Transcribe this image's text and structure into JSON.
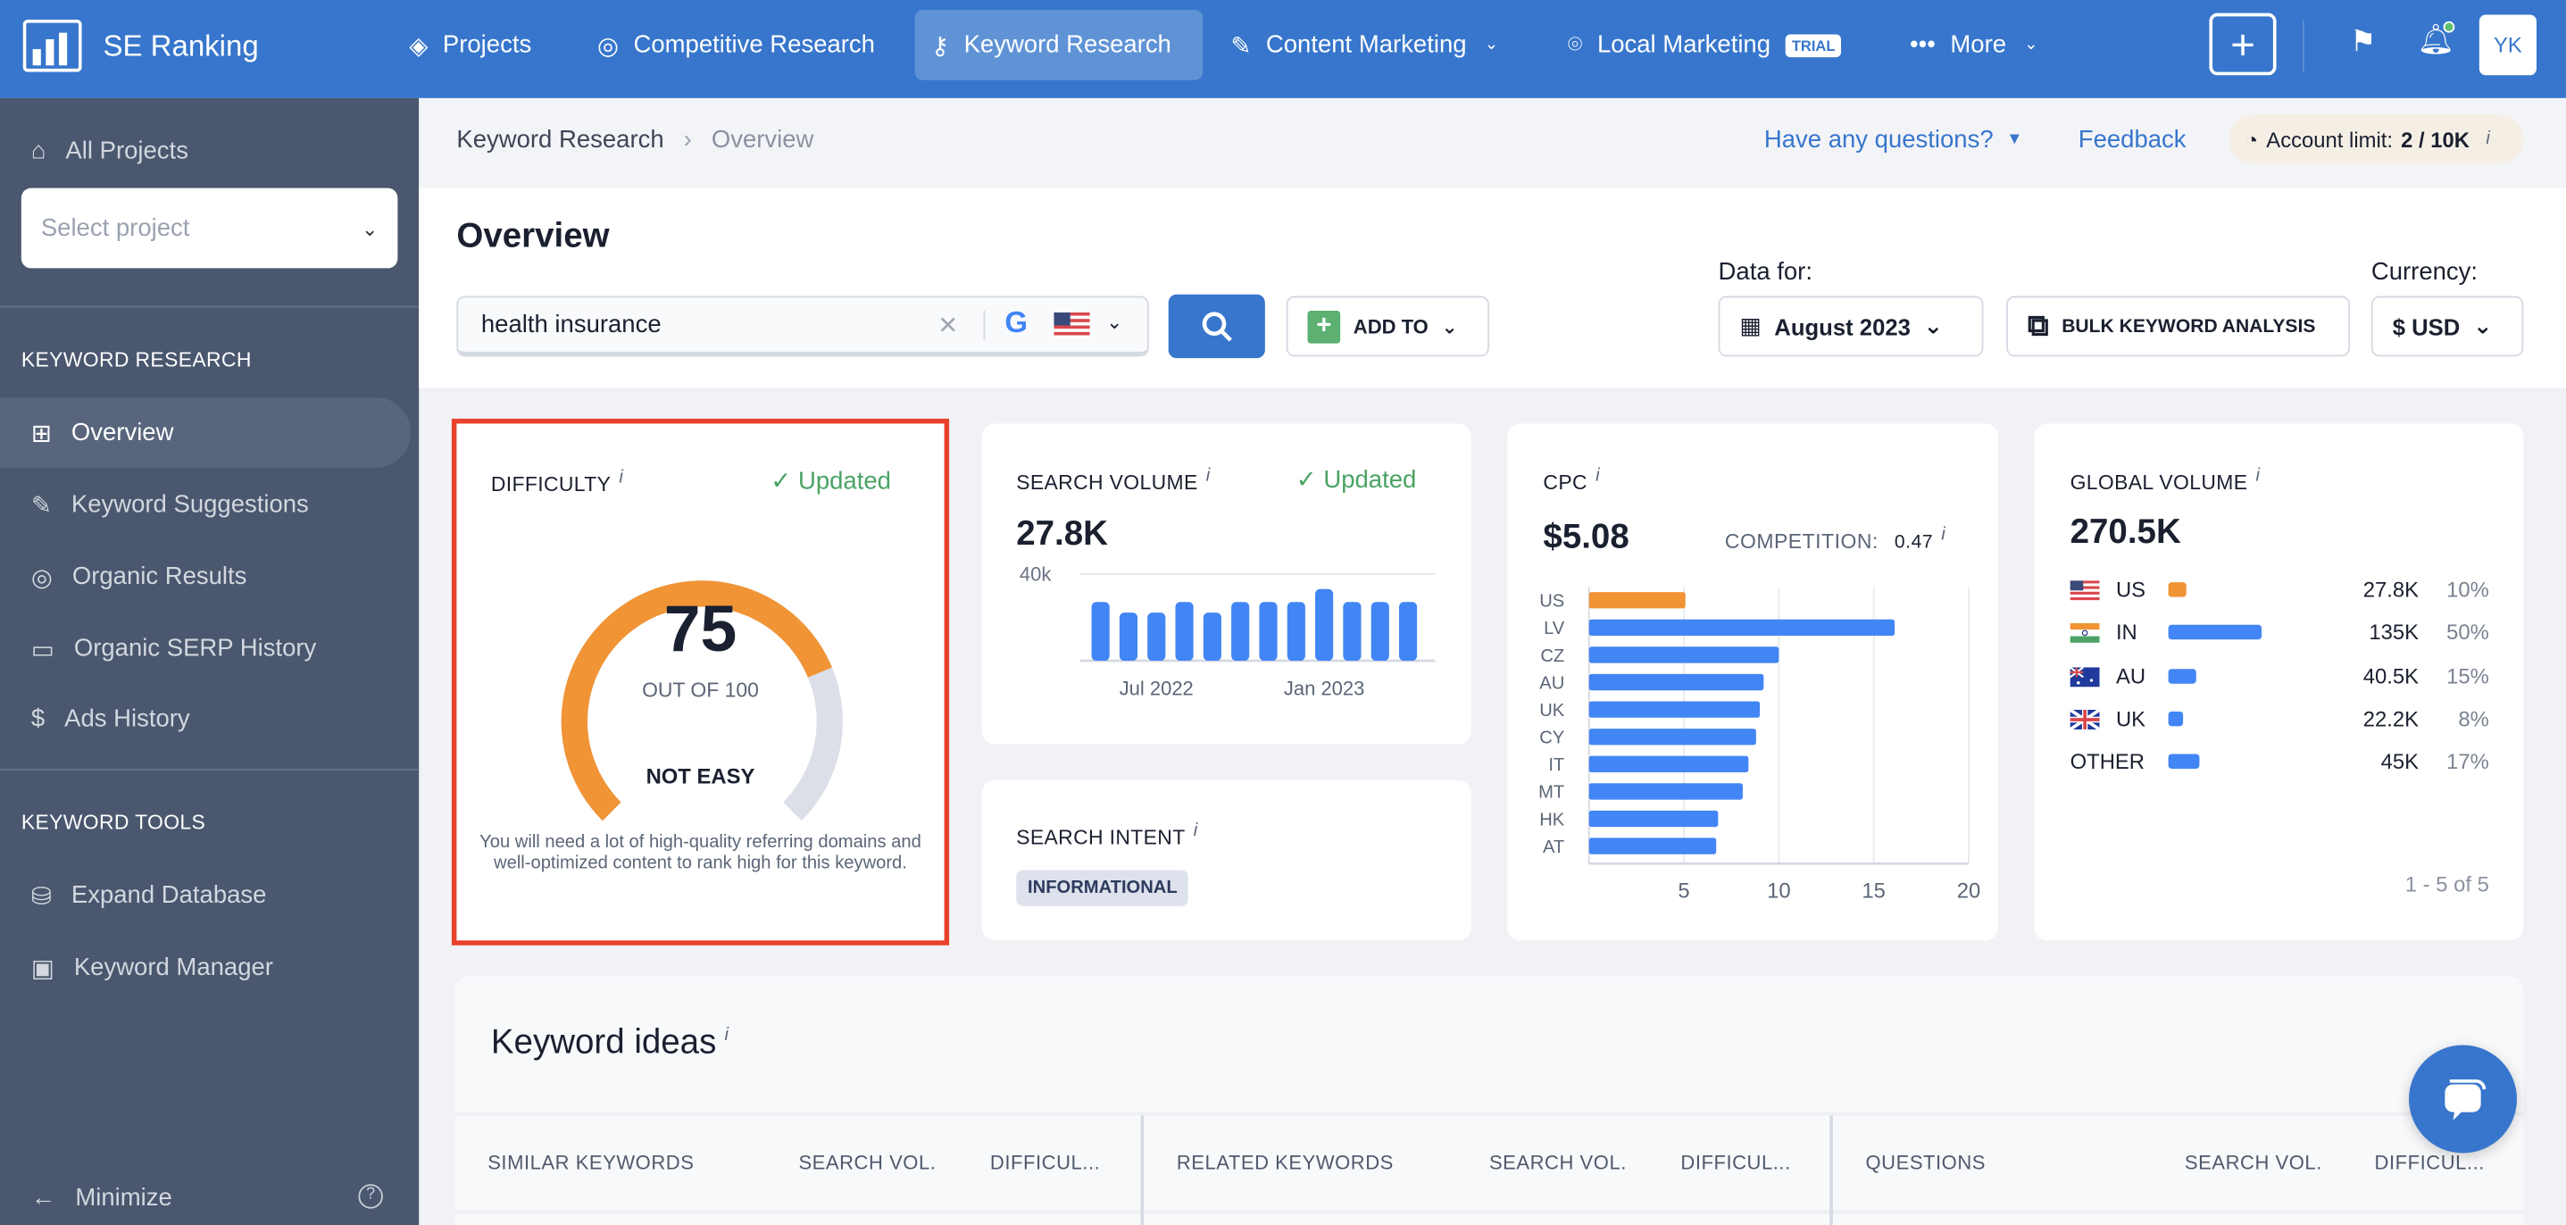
{
  "nav": {
    "brand": "SE Ranking",
    "items": [
      {
        "label": "Projects",
        "icon": "layers-icon"
      },
      {
        "label": "Competitive Research",
        "icon": "target-icon"
      },
      {
        "label": "Keyword Research",
        "icon": "key-icon",
        "active": true
      },
      {
        "label": "Content Marketing",
        "icon": "edit-icon",
        "has_dropdown": true
      },
      {
        "label": "Local Marketing",
        "icon": "map-pin-icon",
        "badge": "TRIAL"
      },
      {
        "label": "More",
        "icon": "more-dots-icon",
        "has_dropdown": true
      }
    ],
    "avatar": "YK",
    "accent": "#3776cc"
  },
  "sidebar": {
    "all_projects": "All Projects",
    "select_placeholder": "Select project",
    "section1": "KEYWORD RESEARCH",
    "items1": [
      {
        "label": "Overview",
        "icon": "grid-icon",
        "active": true
      },
      {
        "label": "Keyword Suggestions",
        "icon": "pencil-icon"
      },
      {
        "label": "Organic Results",
        "icon": "target-icon"
      },
      {
        "label": "Organic SERP History",
        "icon": "archive-icon"
      },
      {
        "label": "Ads History",
        "icon": "dollar-icon"
      }
    ],
    "section2": "KEYWORD TOOLS",
    "items2": [
      {
        "label": "Expand Database",
        "icon": "database-icon"
      },
      {
        "label": "Keyword Manager",
        "icon": "briefcase-icon"
      }
    ],
    "minimize": "Minimize"
  },
  "breadcrumb": {
    "parent": "Keyword Research",
    "current": "Overview"
  },
  "topbar": {
    "questions": "Have any questions?",
    "feedback": "Feedback",
    "account_limit_label": "Account limit:",
    "account_limit_value": "2 / 10K"
  },
  "page_title": "Overview",
  "search": {
    "value": "health insurance",
    "engine": "Google",
    "country": "US",
    "add_to": "ADD TO"
  },
  "filters": {
    "data_for_label": "Data for:",
    "month": "August 2023",
    "bulk": "BULK KEYWORD ANALYSIS",
    "currency_label": "Currency:",
    "currency": "$ USD"
  },
  "difficulty": {
    "title": "DIFFICULTY",
    "status": "Updated",
    "score": 75,
    "score_text": "75",
    "out_of": "OUT OF 100",
    "level": "NOT EASY",
    "description": "You will need a lot of high-quality referring domains and well-optimized content to rank high for this keyword.",
    "color": "#f09436"
  },
  "search_volume": {
    "title": "SEARCH VOLUME",
    "status": "Updated",
    "value": "27.8K"
  },
  "search_intent": {
    "title": "SEARCH INTENT",
    "tag": "INFORMATIONAL"
  },
  "cpc": {
    "title": "CPC",
    "value": "$5.08",
    "competition_label": "COMPETITION:",
    "competition_value": "0.47"
  },
  "global_volume": {
    "title": "GLOBAL VOLUME",
    "value": "270.5K",
    "rows": [
      {
        "code": "US",
        "volume": "27.8K",
        "pct": "10%",
        "share": 10,
        "flag": "us",
        "highlight": true
      },
      {
        "code": "IN",
        "volume": "135K",
        "pct": "50%",
        "share": 50,
        "flag": "in"
      },
      {
        "code": "AU",
        "volume": "40.5K",
        "pct": "15%",
        "share": 15,
        "flag": "au"
      },
      {
        "code": "UK",
        "volume": "22.2K",
        "pct": "8%",
        "share": 8,
        "flag": "uk"
      },
      {
        "code": "OTHER",
        "volume": "45K",
        "pct": "17%",
        "share": 17
      }
    ],
    "pagination": "1 - 5 of 5"
  },
  "chart_data": [
    {
      "type": "bar",
      "values": [
        27100,
        22200,
        22200,
        27100,
        22200,
        27100,
        27100,
        27100,
        33100,
        27100,
        27100,
        27100
      ],
      "x_ticks": [
        {
          "index": 2,
          "label": "Jul 2022"
        },
        {
          "index": 8,
          "label": "Jan 2023"
        }
      ],
      "y_ticks": [
        {
          "value": 40000,
          "label": "40k"
        }
      ],
      "ylim": [
        0,
        40000
      ],
      "color": "#4285f4"
    },
    {
      "type": "bar",
      "orientation": "horizontal",
      "categories": [
        "US",
        "LV",
        "CZ",
        "AU",
        "UK",
        "CY",
        "IT",
        "MT",
        "HK",
        "AT"
      ],
      "values": [
        5.08,
        16.1,
        10.0,
        9.2,
        9.0,
        8.8,
        8.4,
        8.1,
        6.8,
        6.7
      ],
      "xlim": [
        0,
        20
      ],
      "x_ticks": [
        "5",
        "10",
        "15",
        "20"
      ],
      "grid": true,
      "colors": {
        "highlight": "#f09436",
        "default": "#4285f4"
      }
    }
  ],
  "keyword_ideas": {
    "title": "Keyword ideas",
    "columns": [
      {
        "label": "SIMILAR KEYWORDS"
      },
      {
        "label": "SEARCH VOL."
      },
      {
        "label": "DIFFICUL..."
      },
      {
        "label": "RELATED KEYWORDS"
      },
      {
        "label": "SEARCH VOL."
      },
      {
        "label": "DIFFICUL..."
      },
      {
        "label": "QUESTIONS"
      },
      {
        "label": "SEARCH VOL."
      },
      {
        "label": "DIFFICUL..."
      }
    ]
  }
}
